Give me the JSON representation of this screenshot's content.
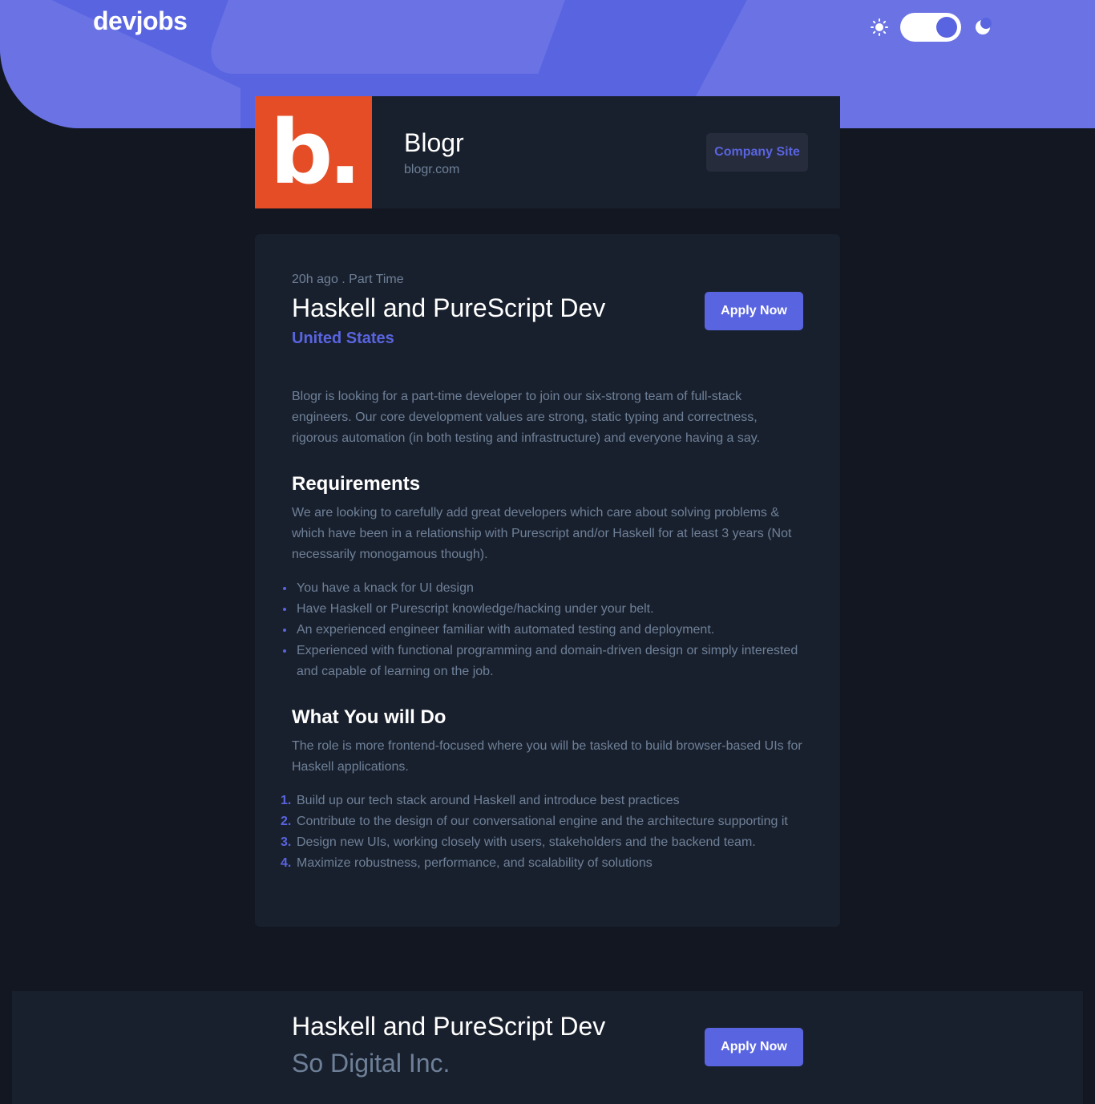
{
  "header": {
    "logo": "devjobs",
    "theme_icons": {
      "light": "sun-icon",
      "dark": "moon-icon"
    }
  },
  "company": {
    "logo_text": "b.",
    "logo_color": "#E54D26",
    "name": "Blogr",
    "domain": "blogr.com",
    "site_button": "Company Site"
  },
  "job": {
    "meta": "20h ago . Part Time",
    "title": "Haskell and PureScript Dev",
    "location": "United States",
    "apply_button": "Apply Now",
    "description": "Blogr is looking for a part-time developer to join our six-strong team of full-stack engineers. Our core development values are strong, static typing and correctness, rigorous automation (in both testing and infrastructure) and everyone having a say.",
    "requirements": {
      "title": "Requirements",
      "text": "We are looking to carefully add great developers which care about solving problems & which have been in a relationship with Purescript and/or Haskell for at least 3 years (Not necessarily monogamous though).",
      "items": [
        "You have a knack for UI design",
        "Have Haskell or Purescript knowledge/hacking under your belt.",
        "An experienced engineer familiar with automated testing and deployment.",
        "Experienced with functional programming and domain-driven design or simply interested and capable of learning on the job."
      ]
    },
    "role": {
      "title": "What You will Do",
      "text": "The role is more frontend-focused where you will be tasked to build browser-based UIs for Haskell applications.",
      "items": [
        "Build up our tech stack around Haskell and introduce best practices",
        "Contribute to the design of our conversational engine and the architecture supporting it",
        "Design new UIs, working closely with users, stakeholders and the backend team.",
        "Maximize robustness, performance, and scalability of solutions"
      ]
    }
  },
  "footer": {
    "title": "Haskell and PureScript Dev",
    "company": "So Digital Inc.",
    "apply_button": "Apply Now"
  },
  "colors": {
    "accent": "#5964E0",
    "background": "#121721",
    "card": "#19202D",
    "muted_text": "#6E8098"
  }
}
